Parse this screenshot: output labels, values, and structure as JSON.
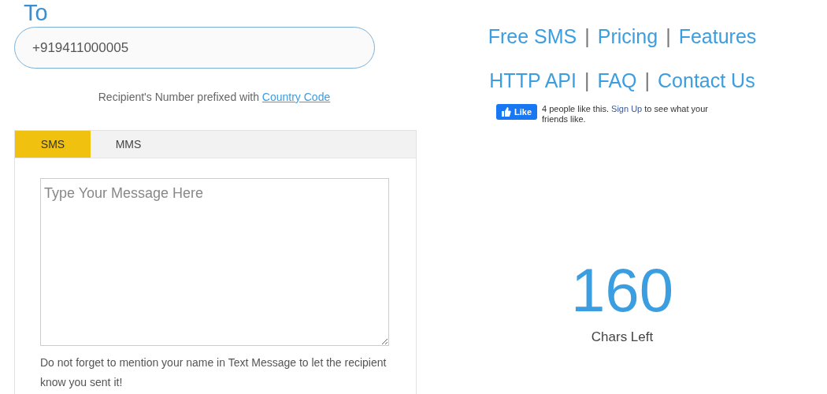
{
  "recipient": {
    "label": "To",
    "value": "+919411000005",
    "hint": {
      "text": "Recipient's Number prefixed with",
      "link": "Country Code"
    }
  },
  "tabs": [
    {
      "label": "SMS",
      "selected": true
    },
    {
      "label": "MMS",
      "selected": false
    }
  ],
  "message": {
    "placeholder": "Type Your Message Here",
    "note": "Do not forget to mention your name in Text Message to let the recipient know you sent it!"
  },
  "nav": [
    [
      {
        "kind": "link",
        "label": "Free SMS"
      },
      {
        "kind": "separator",
        "label": "|"
      },
      {
        "kind": "link",
        "label": "Pricing"
      },
      {
        "kind": "separator",
        "label": "|"
      },
      {
        "kind": "link",
        "label": "Features"
      }
    ],
    [
      {
        "kind": "link",
        "label": "HTTP API"
      },
      {
        "kind": "separator",
        "label": "|"
      },
      {
        "kind": "link",
        "label": "FAQ"
      },
      {
        "kind": "separator",
        "label": "|"
      },
      {
        "kind": "link",
        "label": "Contact Us"
      }
    ]
  ],
  "like": {
    "button": "Like",
    "before": "4 people like this.",
    "link": "Sign Up",
    "after": "to see what your friends like."
  },
  "counter": {
    "value": "160",
    "label": "Chars Left"
  }
}
